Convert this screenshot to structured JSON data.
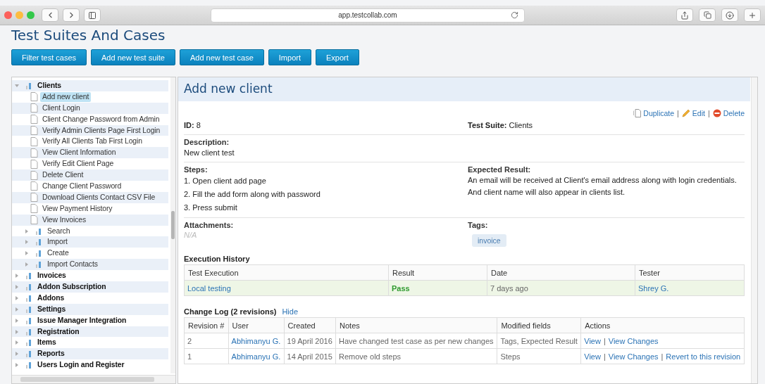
{
  "browser": {
    "url": "app.testcollab.com"
  },
  "page": {
    "title": "Test Suites And Cases"
  },
  "toolbar": [
    "Filter test cases",
    "Add new test suite",
    "Add new test case",
    "Import",
    "Export"
  ],
  "tree": [
    {
      "label": "Clients",
      "kind": "suite",
      "expanded": true,
      "selected": false,
      "children": [
        {
          "label": "Add new client",
          "kind": "case",
          "selected": true
        },
        {
          "label": "Client Login",
          "kind": "case",
          "selected": false
        },
        {
          "label": "Client Change Password from Admin",
          "kind": "case",
          "selected": false
        },
        {
          "label": "Verify Admin Clients Page First Login",
          "kind": "case",
          "selected": false
        },
        {
          "label": "Verify All Clients Tab First Login",
          "kind": "case",
          "selected": false
        },
        {
          "label": "View Client Information",
          "kind": "case",
          "selected": false
        },
        {
          "label": "Verify Edit Client Page",
          "kind": "case",
          "selected": false
        },
        {
          "label": "Delete Client",
          "kind": "case",
          "selected": false
        },
        {
          "label": "Change Client Password",
          "kind": "case",
          "selected": false
        },
        {
          "label": "Download Clients Contact CSV File",
          "kind": "case",
          "selected": false
        },
        {
          "label": "View Payment History",
          "kind": "case",
          "selected": false
        },
        {
          "label": "View Invoices",
          "kind": "case",
          "selected": false
        },
        {
          "label": "Search",
          "kind": "suite",
          "expanded": false,
          "selected": false
        },
        {
          "label": "Import",
          "kind": "suite",
          "expanded": false,
          "selected": false
        },
        {
          "label": "Create",
          "kind": "suite",
          "expanded": false,
          "selected": false
        },
        {
          "label": "Import Contacts",
          "kind": "suite",
          "expanded": false,
          "selected": false
        }
      ]
    },
    {
      "label": "Invoices",
      "kind": "suite",
      "expanded": false,
      "selected": false
    },
    {
      "label": "Addon Subscription",
      "kind": "suite",
      "expanded": false,
      "selected": false
    },
    {
      "label": "Addons",
      "kind": "suite",
      "expanded": false,
      "selected": false
    },
    {
      "label": "Settings",
      "kind": "suite",
      "expanded": false,
      "selected": false
    },
    {
      "label": "Issue Manager Integration",
      "kind": "suite",
      "expanded": false,
      "selected": false
    },
    {
      "label": "Registration",
      "kind": "suite",
      "expanded": false,
      "selected": false
    },
    {
      "label": "Items",
      "kind": "suite",
      "expanded": false,
      "selected": false
    },
    {
      "label": "Reports",
      "kind": "suite",
      "expanded": false,
      "selected": false
    },
    {
      "label": "Users Login and Register",
      "kind": "suite",
      "expanded": false,
      "selected": false
    }
  ],
  "detail": {
    "title": "Add new client",
    "action_separator": "|",
    "actions": [
      {
        "label": "Duplicate",
        "kind": "duplicate"
      },
      {
        "label": "Edit",
        "kind": "edit"
      },
      {
        "label": "Delete",
        "kind": "delete"
      }
    ],
    "id": {
      "label": "ID:",
      "value": "8"
    },
    "suite": {
      "label": "Test Suite:",
      "value": "Clients"
    },
    "description": {
      "label": "Description:",
      "value": "New client test"
    },
    "steps": {
      "label": "Steps:",
      "items": [
        "1. Open client add page",
        "2. Fill the add form along with password",
        "3. Press submit"
      ]
    },
    "expected": {
      "label": "Expected Result:",
      "lines": [
        "An email will be received at Client's email address along with login credentials.",
        "And client name will also appear in clients list."
      ]
    },
    "attachments": {
      "label": "Attachments:",
      "value": "N/A"
    },
    "tags": {
      "label": "Tags:",
      "items": [
        "invoice"
      ]
    }
  },
  "execution_history": {
    "title": "Execution History",
    "columns": [
      "Test Execution",
      "Result",
      "Date",
      "Tester"
    ],
    "rows": [
      {
        "execution": "Local testing",
        "result": "Pass",
        "passed": true,
        "date": "7 days ago",
        "tester": "Shrey G."
      }
    ]
  },
  "change_log": {
    "title": "Change Log (2 revisions)",
    "toggle": "Hide",
    "action_separator": "|",
    "columns": [
      "Revision #",
      "User",
      "Created",
      "Notes",
      "Modified fields",
      "Actions"
    ],
    "rows": [
      {
        "revision": "2",
        "user": "Abhimanyu G.",
        "created": "19 April 2016",
        "notes": "Have changed test case as per new changes",
        "fields": "Tags, Expected Result",
        "actions": [
          "View",
          "View Changes"
        ]
      },
      {
        "revision": "1",
        "user": "Abhimanyu G.",
        "created": "14 April 2015",
        "notes": "Remove old steps",
        "fields": "Steps",
        "actions": [
          "View",
          "View Changes",
          "Revert to this revision"
        ]
      }
    ]
  }
}
